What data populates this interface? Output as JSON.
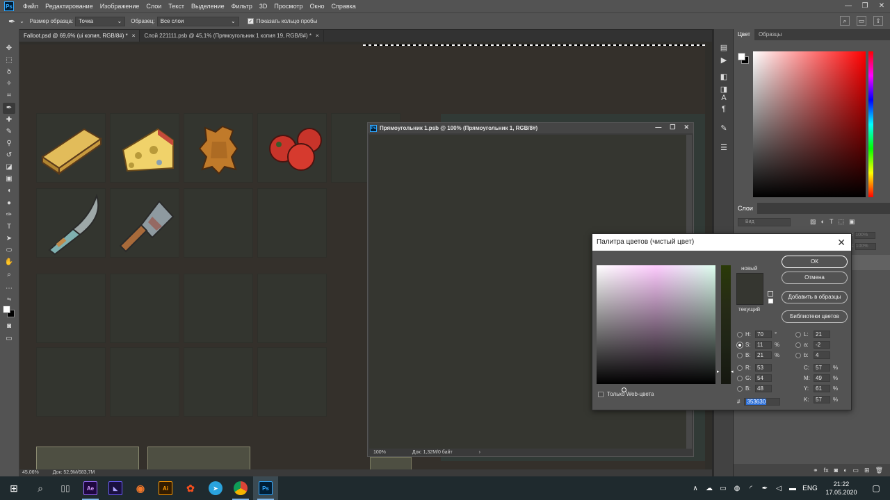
{
  "app": {
    "logo": "Ps",
    "menu": [
      "Файл",
      "Редактирование",
      "Изображение",
      "Слои",
      "Текст",
      "Выделение",
      "Фильтр",
      "3D",
      "Просмотр",
      "Окно",
      "Справка"
    ],
    "window_controls": [
      "—",
      "❐",
      "✕"
    ]
  },
  "options": {
    "sample_size_label": "Размер образца:",
    "sample_size_value": "Точка",
    "sample_label": "Образец:",
    "sample_value": "Все слои",
    "show_ring_label": "Показать кольцо пробы"
  },
  "tabs": [
    {
      "label": "Falloot.psd @ 69,6% (ui копия, RGB/8#) *",
      "close": "×"
    },
    {
      "label": "Слой 221111.psb @ 45,1% (Прямоугольник 1 копия 19, RGB/8#) *",
      "close": "×"
    }
  ],
  "status_main": {
    "zoom": "45,06%",
    "doc": "Док: 52,9M/683,7M"
  },
  "float_window": {
    "title": "Прямоугольник 1.psb @ 100% (Прямоугольник 1, RGB/8#)",
    "zoom": "100%",
    "doc": "Док: 1,32M/0 байт",
    "arrow": "›"
  },
  "right_panel": {
    "color_tab": "Цвет",
    "swatches_tab": "Образцы",
    "layers_tab": "Слои",
    "search_placeholder": "Вид",
    "opacity_suffix_1": "сть:",
    "opacity_suffix_2": "вка:",
    "opacity_value": "100%"
  },
  "picker": {
    "title": "Палитра цветов (чистый цвет)",
    "new_label": "новый",
    "current_label": "текущий",
    "ok": "ОК",
    "cancel": "Отмена",
    "add_swatch": "Добавить в образцы",
    "libraries": "Библиотеки цветов",
    "web_only": "Только Web-цвета",
    "fields": {
      "H": {
        "label": "H:",
        "value": "70",
        "unit": "°"
      },
      "S": {
        "label": "S:",
        "value": "11",
        "unit": "%"
      },
      "Bv": {
        "label": "B:",
        "value": "21",
        "unit": "%"
      },
      "R": {
        "label": "R:",
        "value": "53"
      },
      "G": {
        "label": "G:",
        "value": "54"
      },
      "Bc": {
        "label": "B:",
        "value": "48"
      },
      "L": {
        "label": "L:",
        "value": "21"
      },
      "a": {
        "label": "a:",
        "value": "-2"
      },
      "b": {
        "label": "b:",
        "value": "4"
      },
      "C": {
        "label": "C:",
        "value": "57",
        "unit": "%"
      },
      "M": {
        "label": "M:",
        "value": "49",
        "unit": "%"
      },
      "Y": {
        "label": "Y:",
        "value": "61",
        "unit": "%"
      },
      "K": {
        "label": "K:",
        "value": "57",
        "unit": "%"
      }
    },
    "hash": "#",
    "hex": "353630"
  },
  "taskbar": {
    "start": "⊞",
    "lang": "ENG",
    "time": "21:22",
    "date": "17.05.2020"
  },
  "colors": {
    "accent": "#31a8ff",
    "current_color": "#353630"
  }
}
